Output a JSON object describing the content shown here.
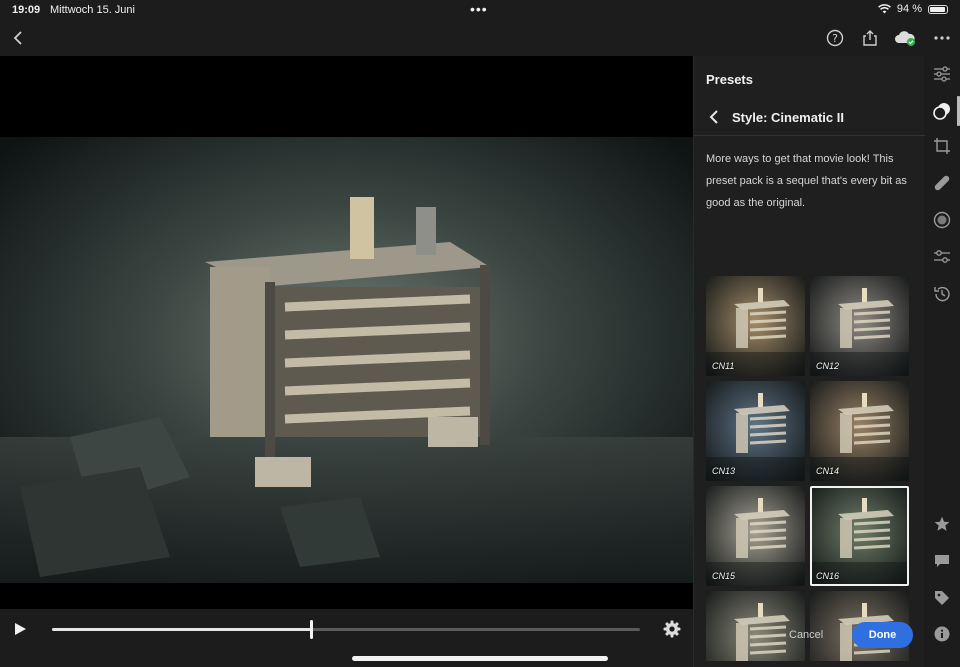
{
  "status_bar": {
    "time": "19:09",
    "date": "Mittwoch 15. Juni",
    "battery": "94 %",
    "battery_level": 0.94
  },
  "toolbar": {
    "icons": [
      "back-icon",
      "help-icon",
      "share-icon",
      "cloud-sync-icon",
      "more-icon"
    ]
  },
  "playback": {
    "progress": 0.44
  },
  "panel": {
    "title": "Presets",
    "style_title": "Style: Cinematic II",
    "description": "More ways to get that movie look! This preset pack is a sequel that's every bit as good as the original.",
    "presets": [
      {
        "label": "CN11",
        "tint": "#a58d6a",
        "selected": false
      },
      {
        "label": "CN12",
        "tint": "#8f8a84",
        "selected": false
      },
      {
        "label": "CN13",
        "tint": "#5f7488",
        "selected": false
      },
      {
        "label": "CN14",
        "tint": "#9a8266",
        "selected": false
      },
      {
        "label": "CN15",
        "tint": "#a7a396",
        "selected": false
      },
      {
        "label": "CN16",
        "tint": "#6f7e6a",
        "selected": true
      },
      {
        "label": "",
        "tint": "#8b8a7a",
        "selected": false
      },
      {
        "label": "",
        "tint": "#7f7466",
        "selected": false
      }
    ],
    "cancel_label": "Cancel",
    "done_label": "Done",
    "accent": "#2f6fe0"
  },
  "rail": {
    "icons": [
      "edit-sliders-icon",
      "presets-icon",
      "crop-icon",
      "healing-icon",
      "masking-icon",
      "versions-icon",
      "history-icon",
      "rating-icon",
      "comment-icon",
      "keyword-icon",
      "info-icon"
    ]
  }
}
